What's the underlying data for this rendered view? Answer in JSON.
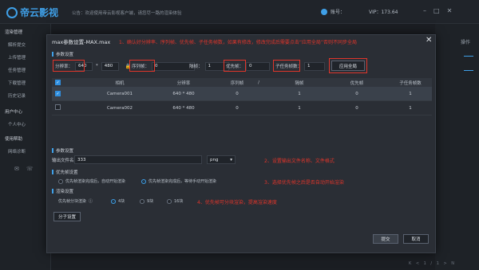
{
  "app": {
    "logo": "帝云影视",
    "notice": "公告：欢迎使用帝云影视客户端，请您尽一路的渲染体验",
    "account": "账号：",
    "vip": "VIP：173.64",
    "window_controls": [
      "minimize-icon",
      "maximize-icon",
      "close-icon"
    ]
  },
  "sidebar": {
    "items": [
      {
        "label": "渲染管理",
        "section": true
      },
      {
        "label": "解析提交"
      },
      {
        "label": "上传管理"
      },
      {
        "label": "任务管理"
      },
      {
        "label": "下载管理"
      },
      {
        "label": "历史记录"
      },
      {
        "label": "用户中心",
        "section": true
      },
      {
        "label": "个人中心"
      },
      {
        "label": "使用帮助",
        "section": true
      },
      {
        "label": "网络诊断"
      }
    ]
  },
  "right": {
    "op_label": "操作"
  },
  "pager": "K < 1 / 1 > N",
  "modal": {
    "title": "max参数设置-MAX.max",
    "annotation_1": "1、确认好分辨率、序列帧、优先帧、子任务帧数，如果有修改，修改完成后需要点击“应用全局”否则不同步全局",
    "section_params": "参数设置",
    "fields": {
      "resolution_label": "分辨率：",
      "res_w": "640",
      "res_x": "*",
      "res_h": "480",
      "frames_label": "序列帧：",
      "frames_value": "0",
      "interval_label": "隔帧：",
      "interval_value": "1",
      "priority_label": "优先帧：",
      "priority_value": "0",
      "subtask_label": "子任务帧数：",
      "subtask_value": "1",
      "apply_button": "应用全局"
    },
    "table": {
      "headers": [
        "相机",
        "分辨率",
        "序列帧",
        "/",
        "隔帧",
        "优先帧",
        "子任务帧数"
      ],
      "rows": [
        {
          "camera": "Camera001",
          "resolution": "640 * 480",
          "frames": "0",
          "interval": "1",
          "priority": "0",
          "subtask": "1",
          "selected": true
        },
        {
          "camera": "Camera002",
          "resolution": "640 * 480",
          "frames": "0",
          "interval": "1",
          "priority": "0",
          "subtask": "1",
          "selected": false
        }
      ]
    },
    "section_params2": "参数设置",
    "output_label": "输出文件名：",
    "output_value": "333",
    "format_value": "png",
    "annotation_2": "2、设置输出文件名称、文件格式",
    "section_priority": "优先帧设置",
    "priority_opt1": "优先帧渲染完成后，自动开始渲染",
    "priority_opt2": "优先帧渲染完成后，等待手动开始渲染",
    "annotation_3": "3、选择优先帧之后是否自动开始渲染",
    "section_render": "渲染设置",
    "tile_label": "优先帧分块渲染",
    "tile_opts": [
      "4块",
      "9块",
      "16块"
    ],
    "annotation_4": "4、优先帧可分块渲染，提高渲染速度",
    "subtask_button": "分子设置",
    "submit_button": "提交",
    "cancel_button": "取消"
  }
}
